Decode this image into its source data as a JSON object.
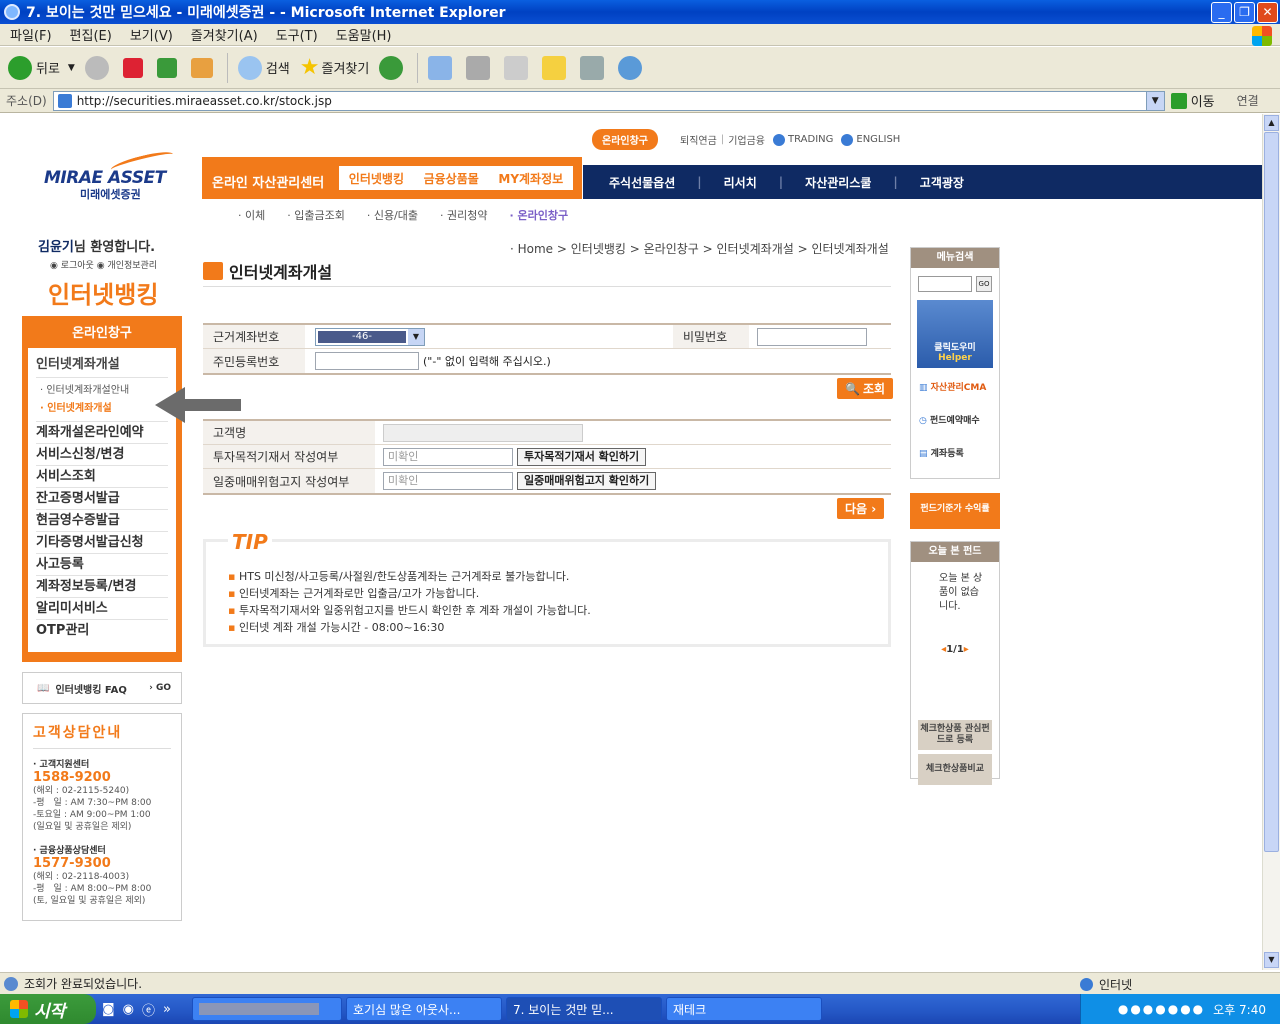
{
  "window": {
    "title": "7. 보이는 것만 믿으세요 - 미래에셋증권 - - Microsoft Internet Explorer"
  },
  "menu": [
    "파일(F)",
    "편집(E)",
    "보기(V)",
    "즐겨찾기(A)",
    "도구(T)",
    "도움말(H)"
  ],
  "toolbar": {
    "back": "뒤로",
    "search": "검색",
    "favorites": "즐겨찾기"
  },
  "address": {
    "label": "주소(D)",
    "url": "http://securities.miraeasset.co.kr/stock.jsp",
    "go": "이동",
    "links": "연결"
  },
  "site": {
    "logo": "MIRAE ASSET",
    "logo_sub": "미래에셋증권",
    "util": {
      "online": "온라인창구",
      "retire": "퇴직연금",
      "corp": "기업금융",
      "trading": "TRADING",
      "english": "ENGLISH"
    },
    "topnav": {
      "label": "온라인 자산관리센터",
      "tabs": [
        "인터넷뱅킹",
        "금융상품몰",
        "MY계좌정보"
      ]
    },
    "bluenav": [
      "주식선물옵션",
      "리서치",
      "자산관리스쿨",
      "고객광장"
    ],
    "subnav": [
      "· 이체",
      "· 입출금조회",
      "· 신용/대출",
      "· 권리청약",
      "· 온라인창구"
    ]
  },
  "left": {
    "user": "김윤기",
    "welcome": "님 환영합니다.",
    "links": "◉ 로그아웃  ◉ 개인정보관리",
    "section": "인터넷뱅킹",
    "box_title": "온라인창구",
    "menu_first": "인터넷계좌개설",
    "sub_items": [
      "· 인터넷계좌개설안내",
      "· 인터넷계좌개설"
    ],
    "menu": [
      "계좌개설온라인예약",
      "서비스신청/변경",
      "서비스조회",
      "잔고증명서발급",
      "현금영수증발급",
      "기타증명서발급신청",
      "사고등록",
      "계좌정보등록/변경",
      "알리미서비스",
      "OTP관리"
    ],
    "faq": "인터넷뱅킹 FAQ",
    "faq_go": "› GO",
    "cs_title": "고객상담안내",
    "cs1_name": "· 고객지원센터",
    "cs1_phone": "1588-9200",
    "cs1_overseas": "(해외 : 02-2115-5240)",
    "cs1_hours1": "-평　일 : AM 7:30~PM 8:00",
    "cs1_hours2": "-토요일 : AM 9:00~PM 1:00",
    "cs1_note": "(일요일 및 공휴일은 제외)",
    "cs2_name": "· 금융상품상담센터",
    "cs2_phone": "1577-9300",
    "cs2_overseas": "(해외 : 02-2118-4003)",
    "cs2_hours1": "-평　일 : AM 8:00~PM 8:00",
    "cs2_note": "(토, 일요일 및 공휴일은 제외)"
  },
  "main": {
    "breadcrumb": "· Home > 인터넷뱅킹 > 온라인창구 > 인터넷계좌개설 > 인터넷계좌개설",
    "title": "인터넷계좌개설",
    "form1": {
      "acct_label": "근거계좌번호",
      "acct_value": "-46-",
      "pw_label": "비밀번호",
      "rrn_label": "주민등록번호",
      "rrn_note": "(\"-\" 없이 입력해 주십시오.)"
    },
    "query_btn": "조회",
    "form2": {
      "name_label": "고객명",
      "purpose_label": "투자목적기재서 작성여부",
      "purpose_value": "미확인",
      "purpose_btn": "투자목적기재서 확인하기",
      "daytrade_label": "일중매매위험고지 작성여부",
      "daytrade_value": "미확인",
      "daytrade_btn": "일중매매위험고지 확인하기"
    },
    "next_btn": "다음 ›",
    "tip_label": "TIP",
    "tips": [
      "HTS 미신청/사고등록/사절원/한도상품계좌는 근거계좌로 불가능합니다.",
      "인터넷계좌는 근거계좌로만 입출금/고가 가능합니다.",
      "투자목적기재서와 일중위험고지를 반드시 확인한 후 계좌 개설이 가능합니다.",
      "인터넷 계좌 개설 가능시간 - 08:00~16:30"
    ]
  },
  "right": {
    "search_title": "메뉴검색",
    "search_go": "GO",
    "helper": "클릭도우미",
    "helper_en": "Helper",
    "link1": "자산관리CMA",
    "link2": "펀드예약매수",
    "link3": "계좌등록",
    "fund_banner": "펀드기준가 수익률",
    "today_title": "오늘 본 펀드",
    "today_empty": "오늘 본 상품이 없습니다.",
    "paging": "1/1",
    "btn1": "체크한상품 관심펀드로 등록",
    "btn2": "체크한상품비교"
  },
  "status": {
    "text": "조회가 완료되었습니다.",
    "zone": "인터넷"
  },
  "taskbar": {
    "start": "시작",
    "tasks": [
      "호기심 많은 아웃사...",
      "7. 보이는 것만 믿...",
      "재테크"
    ],
    "clock": "오후 7:40"
  }
}
